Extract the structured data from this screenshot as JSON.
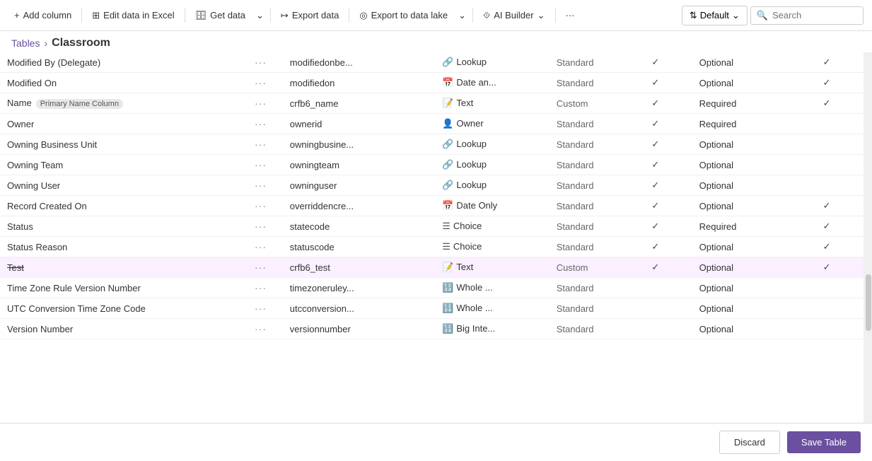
{
  "toolbar": {
    "add_column": "Add column",
    "edit_excel": "Edit data in Excel",
    "get_data": "Get data",
    "export_data": "Export data",
    "export_lake": "Export to data lake",
    "ai_builder": "AI Builder",
    "more": "···",
    "default": "Default",
    "search_placeholder": "Search"
  },
  "breadcrumb": {
    "tables": "Tables",
    "separator": "›",
    "current": "Classroom"
  },
  "columns": {
    "headers": []
  },
  "rows": [
    {
      "name": "Modified By (Delegate)",
      "strikethrough": false,
      "badge": "",
      "dots": "···",
      "logicalName": "modifiedonbe...",
      "typeIcon": "🔗",
      "typeName": "Lookup",
      "managed": "Standard",
      "check1": true,
      "requirement": "Optional",
      "check2": true
    },
    {
      "name": "Modified On",
      "strikethrough": false,
      "badge": "",
      "dots": "···",
      "logicalName": "modifiedon",
      "typeIcon": "📅",
      "typeName": "Date an...",
      "managed": "Standard",
      "check1": true,
      "requirement": "Optional",
      "check2": true
    },
    {
      "name": "Name",
      "strikethrough": false,
      "badge": "Primary Name Column",
      "dots": "···",
      "logicalName": "crfb6_name",
      "typeIcon": "📝",
      "typeName": "Text",
      "managed": "Custom",
      "check1": true,
      "requirement": "Required",
      "check2": true
    },
    {
      "name": "Owner",
      "strikethrough": false,
      "badge": "",
      "dots": "···",
      "logicalName": "ownerid",
      "typeIcon": "👤",
      "typeName": "Owner",
      "managed": "Standard",
      "check1": true,
      "requirement": "Required",
      "check2": false
    },
    {
      "name": "Owning Business Unit",
      "strikethrough": false,
      "badge": "",
      "dots": "···",
      "logicalName": "owningbusine...",
      "typeIcon": "🔗",
      "typeName": "Lookup",
      "managed": "Standard",
      "check1": true,
      "requirement": "Optional",
      "check2": false
    },
    {
      "name": "Owning Team",
      "strikethrough": false,
      "badge": "",
      "dots": "···",
      "logicalName": "owningteam",
      "typeIcon": "🔗",
      "typeName": "Lookup",
      "managed": "Standard",
      "check1": true,
      "requirement": "Optional",
      "check2": false
    },
    {
      "name": "Owning User",
      "strikethrough": false,
      "badge": "",
      "dots": "···",
      "logicalName": "owninguser",
      "typeIcon": "🔗",
      "typeName": "Lookup",
      "managed": "Standard",
      "check1": true,
      "requirement": "Optional",
      "check2": false
    },
    {
      "name": "Record Created On",
      "strikethrough": false,
      "badge": "",
      "dots": "···",
      "logicalName": "overriddencre...",
      "typeIcon": "📅",
      "typeName": "Date Only",
      "managed": "Standard",
      "check1": true,
      "requirement": "Optional",
      "check2": true
    },
    {
      "name": "Status",
      "strikethrough": false,
      "badge": "",
      "dots": "···",
      "logicalName": "statecode",
      "typeIcon": "☰",
      "typeName": "Choice",
      "managed": "Standard",
      "check1": true,
      "requirement": "Required",
      "check2": true
    },
    {
      "name": "Status Reason",
      "strikethrough": false,
      "badge": "",
      "dots": "···",
      "logicalName": "statuscode",
      "typeIcon": "☰",
      "typeName": "Choice",
      "managed": "Standard",
      "check1": true,
      "requirement": "Optional",
      "check2": true
    },
    {
      "name": "Test",
      "strikethrough": true,
      "badge": "",
      "dots": "···",
      "logicalName": "crfb6_test",
      "typeIcon": "📝",
      "typeName": "Text",
      "managed": "Custom",
      "check1": true,
      "requirement": "Optional",
      "check2": true,
      "selected": true
    },
    {
      "name": "Time Zone Rule Version Number",
      "strikethrough": false,
      "badge": "",
      "dots": "···",
      "logicalName": "timezoneruley...",
      "typeIcon": "🔢",
      "typeName": "Whole ...",
      "managed": "Standard",
      "check1": false,
      "requirement": "Optional",
      "check2": false
    },
    {
      "name": "UTC Conversion Time Zone Code",
      "strikethrough": false,
      "badge": "",
      "dots": "···",
      "logicalName": "utcconversion...",
      "typeIcon": "🔢",
      "typeName": "Whole ...",
      "managed": "Standard",
      "check1": false,
      "requirement": "Optional",
      "check2": false
    },
    {
      "name": "Version Number",
      "strikethrough": false,
      "badge": "",
      "dots": "···",
      "logicalName": "versionnumber",
      "typeIcon": "🔢",
      "typeName": "Big Inte...",
      "managed": "Standard",
      "check1": false,
      "requirement": "Optional",
      "check2": false
    }
  ],
  "footer": {
    "discard": "Discard",
    "save": "Save Table"
  },
  "icons": {
    "add": "+",
    "excel": "⊞",
    "get_data": "🗄",
    "export": "↦",
    "lake": "◎",
    "ai": "⟐",
    "search": "🔍",
    "chevron_down": "⌄",
    "sort": "⇅"
  }
}
